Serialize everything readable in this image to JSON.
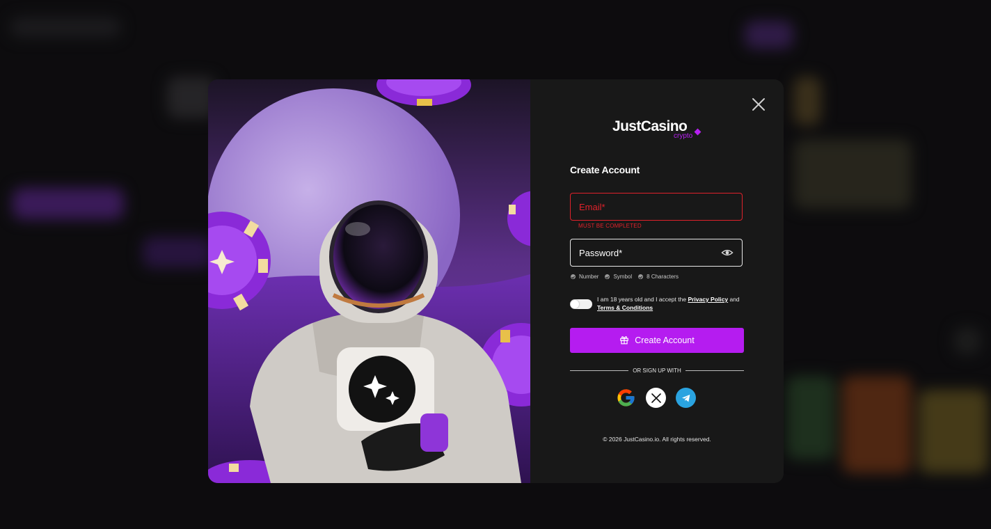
{
  "modal": {
    "logo": {
      "main": "JustCasino",
      "sub": "crypto"
    },
    "title": "Create Account",
    "email": {
      "placeholder": "Email*",
      "error": "MUST BE COMPLETED"
    },
    "password": {
      "placeholder": "Password*"
    },
    "password_rules": [
      "Number",
      "Symbol",
      "8 Characters"
    ],
    "consent": {
      "prefix": "I am 18 years old and I accept the",
      "privacy_link": "Privacy Policy",
      "and": "and",
      "terms_link": "Terms & Conditions"
    },
    "submit_label": "Create Account",
    "divider_text": "OR SIGN UP WITH",
    "social_icons": [
      "google-icon",
      "x-icon",
      "telegram-icon"
    ],
    "copyright": "© 2026 JustCasino.io. All rights reserved."
  },
  "colors": {
    "accent": "#b51cf0",
    "error": "#e0222b",
    "panel_bg": "#181818",
    "telegram": "#2aa3e0"
  }
}
